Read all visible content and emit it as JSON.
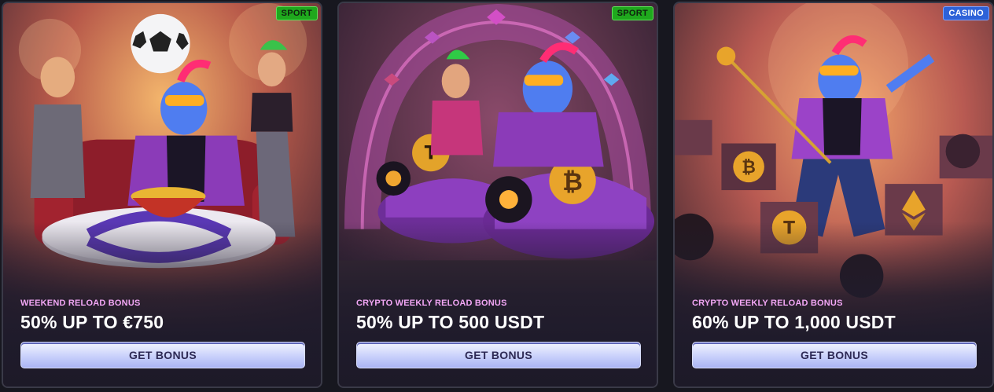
{
  "cards": [
    {
      "tag": "SPORT",
      "subtitle": "WEEKEND RELOAD BONUS",
      "title": "50% UP TO €750",
      "button": "GET BONUS",
      "tag_color": "#1fa81d"
    },
    {
      "tag": "SPORT",
      "subtitle": "CRYPTO WEEKLY RELOAD BONUS",
      "title": "50% UP TO 500 USDT",
      "button": "GET BONUS",
      "tag_color": "#1fa81d"
    },
    {
      "tag": "CASINO",
      "subtitle": "CRYPTO WEEKLY RELOAD BONUS",
      "title": "60% UP TO 1,000 USDT",
      "button": "GET BONUS",
      "tag_color": "#2e62d8"
    }
  ],
  "colors": {
    "subtitle": "#f3a7f6",
    "button_text": "#2e2a55",
    "card_bg": "#201c2c"
  },
  "icons": [
    "soccer-ball",
    "crypto-coin",
    "tether-coin",
    "bitcoin-coin",
    "ethereum-coin"
  ]
}
